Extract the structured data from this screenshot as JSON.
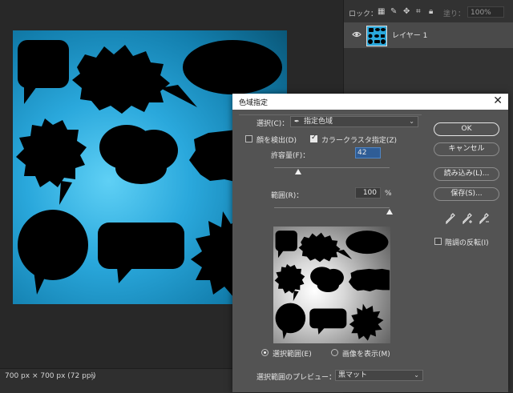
{
  "layers_panel": {
    "lock_label": "ロック：",
    "lock_icons": [
      "transparency-lock-icon",
      "brush-lock-icon",
      "move-lock-icon",
      "artboard-lock-icon",
      "padlock-icon"
    ],
    "fill_label": "塗り：",
    "fill_value": "100%",
    "layer_name": "レイヤー 1"
  },
  "status": {
    "doc_info": "700 px × 700 px (72 ppi)",
    "arrow": "〉"
  },
  "dialog": {
    "title": "色域指定",
    "select_label": "選択(C)：",
    "select_value": "指定色域",
    "detect_faces_label": "顔を検出(D)",
    "detect_faces_checked": false,
    "localized_clusters_label": "カラークラスタ指定(Z)",
    "localized_clusters_checked": true,
    "fuzziness_label": "許容量(F)：",
    "fuzziness_value": "42",
    "fuzziness_max": 200,
    "range_label": "範囲(R)：",
    "range_value": "100",
    "range_unit": "%",
    "buttons": {
      "ok": "OK",
      "cancel": "キャンセル",
      "load": "読み込み(L)...",
      "save": "保存(S)..."
    },
    "invert_label": "階調の反転(I)",
    "invert_checked": false,
    "view_selection_label": "選択範囲(E)",
    "view_image_label": "画像を表示(M)",
    "selected_view": "selection",
    "preview_label": "選択範囲のプレビュー：",
    "preview_value": "黒マット",
    "close_symbol": "✕"
  },
  "colors": {
    "canvas_blue": "#2aa8dc",
    "dialog_bg": "#535353",
    "panel_bg": "#323232"
  }
}
